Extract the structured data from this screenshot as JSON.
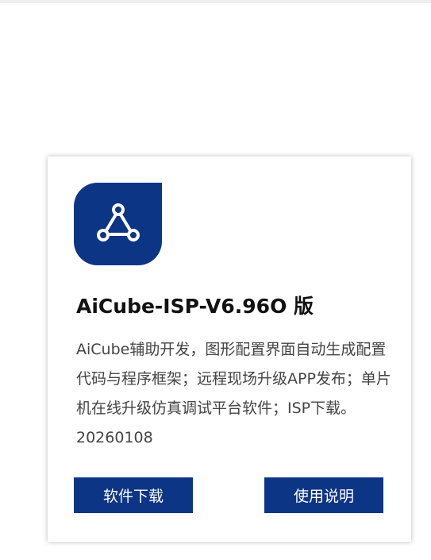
{
  "product": {
    "icon": "share-nodes-icon",
    "title": "AiCube-ISP-V6.96O 版",
    "description": "AiCube辅助开发，图形配置界面自动生成配置代码与程序框架；远程现场升级APP发布；单片机在线升级仿真调试平台软件；ISP下载。20260108",
    "download_label": "软件下载",
    "manual_label": "使用说明"
  },
  "colors": {
    "brand": "#0d3586",
    "background": "#ffffff",
    "text": "#111111",
    "description_text": "#444444"
  }
}
